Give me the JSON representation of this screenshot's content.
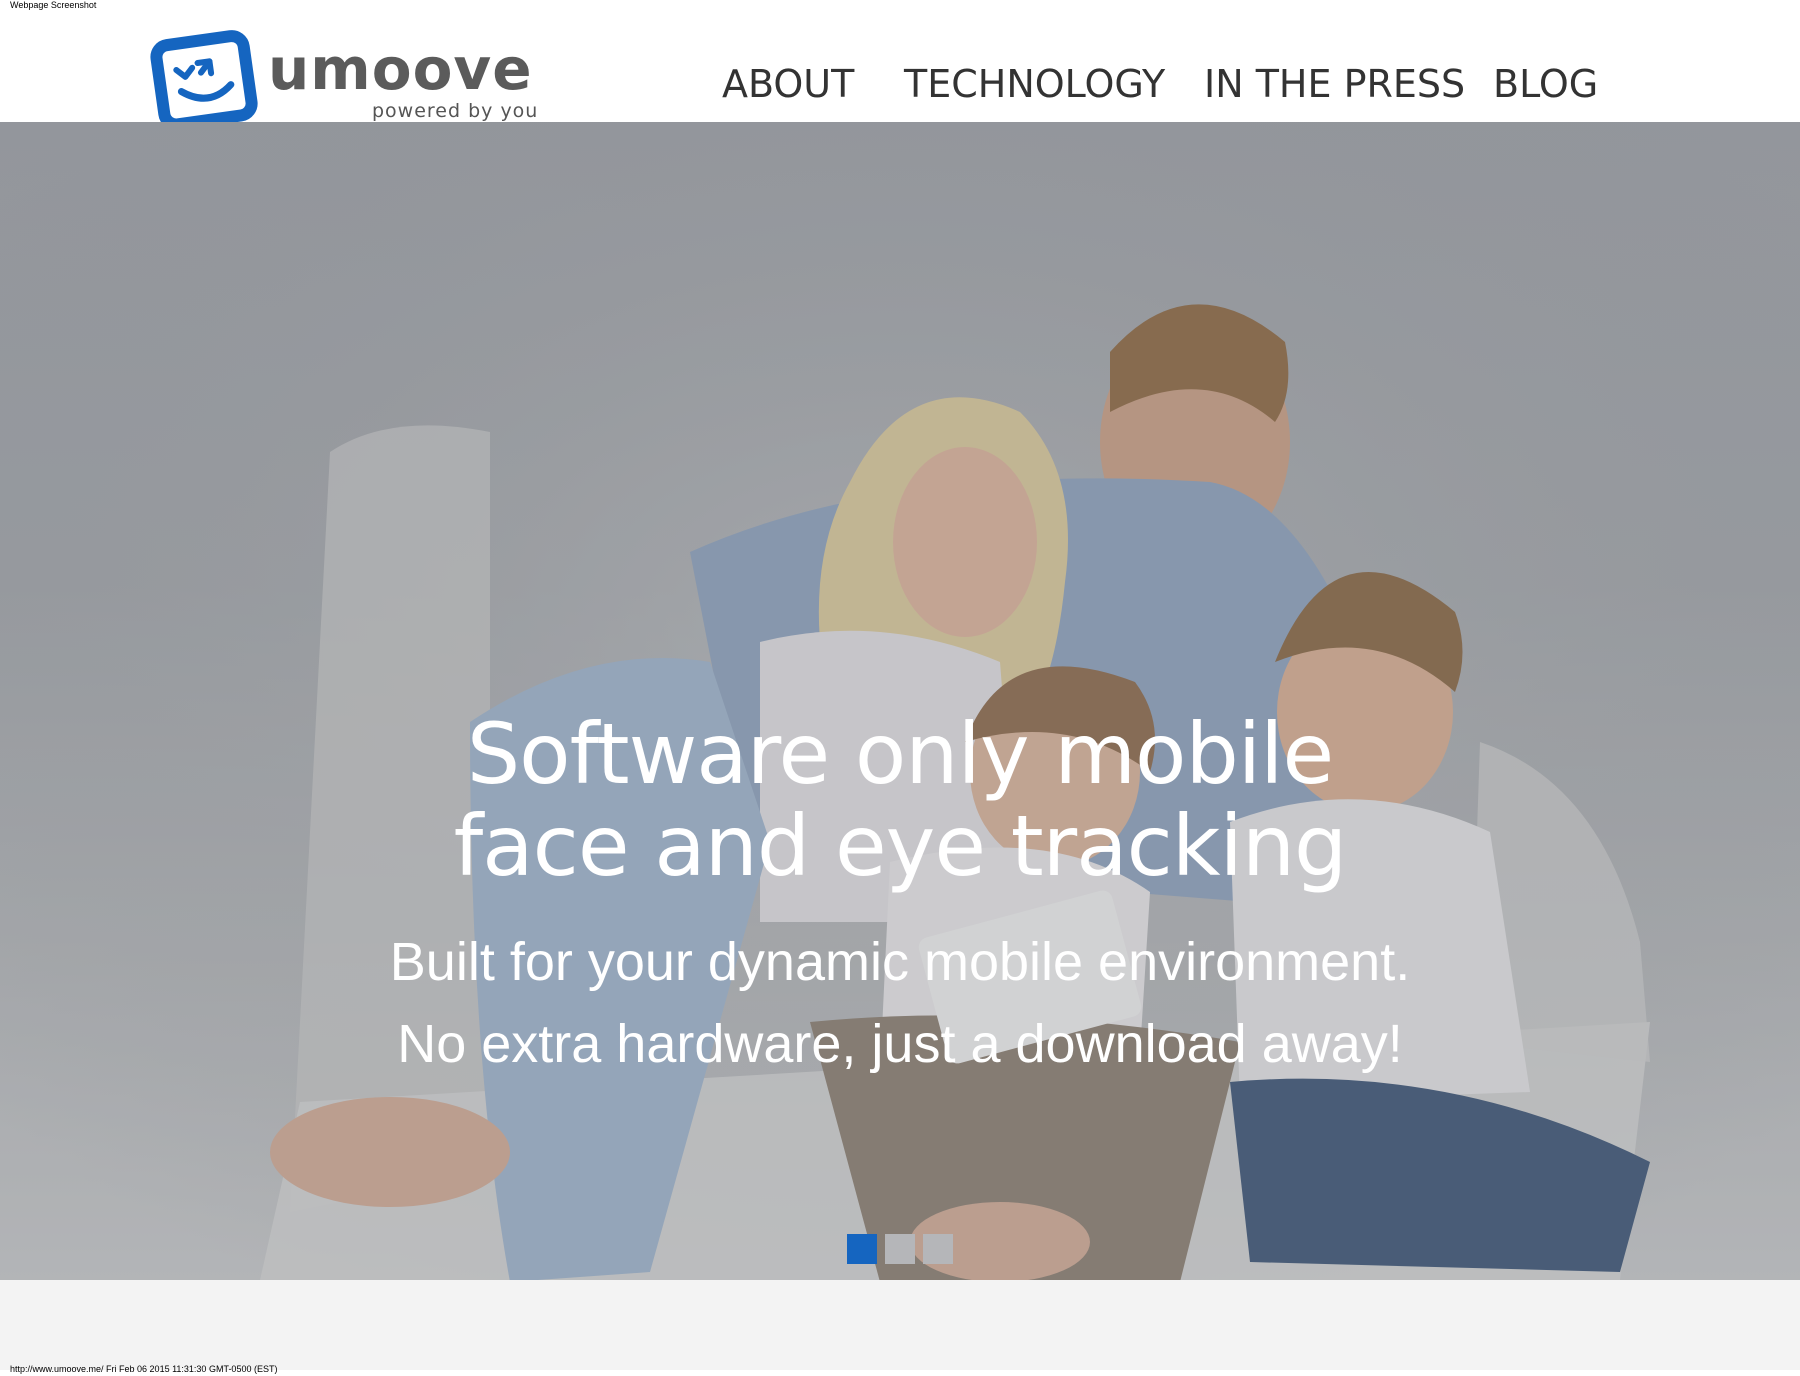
{
  "capture_label": "Webpage Screenshot",
  "brand": {
    "name": "umoove",
    "tagline": "powered by you",
    "colors": {
      "logo_blue": "#1565c0",
      "logo_gray": "#5b5b5b"
    }
  },
  "nav": {
    "items": [
      {
        "label": "ABOUT"
      },
      {
        "label": "TECHNOLOGY"
      },
      {
        "label": "IN THE PRESS"
      },
      {
        "label": "BLOG"
      }
    ]
  },
  "hero": {
    "headline_line1": "Software only mobile",
    "headline_line2": "face and eye tracking",
    "subline1": "Built for your dynamic mobile environment.",
    "subline2": "No extra hardware, just a download away!",
    "slider": {
      "count": 3,
      "active_index": 0,
      "active_color": "#1565c0",
      "inactive_color": "#b5b6b9"
    }
  },
  "footer": {
    "url_timestamp": "http://www.umoove.me/ Fri Feb 06 2015 11:31:30 GMT-0500 (EST)"
  }
}
